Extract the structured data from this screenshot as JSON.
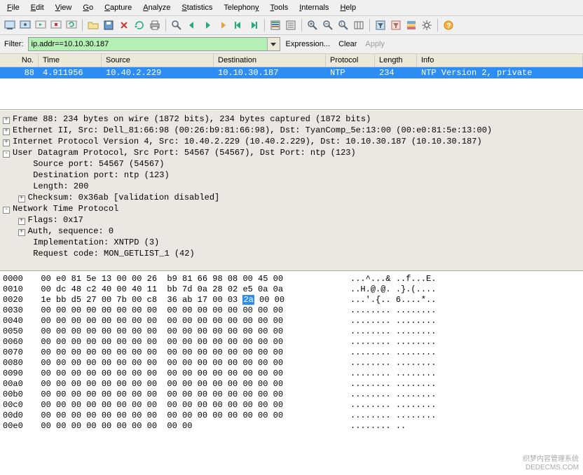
{
  "menubar": [
    {
      "l": "F",
      "t": "ile"
    },
    {
      "l": "E",
      "t": "dit"
    },
    {
      "l": "V",
      "t": "iew"
    },
    {
      "l": "G",
      "t": "o"
    },
    {
      "l": "C",
      "t": "apture"
    },
    {
      "l": "A",
      "t": "nalyze"
    },
    {
      "l": "S",
      "t": "tatistics"
    },
    {
      "l": "",
      "t": "Telephon",
      "l2": "y"
    },
    {
      "l": "T",
      "t": "ools"
    },
    {
      "l": "I",
      "t": "nternals"
    },
    {
      "l": "H",
      "t": "elp"
    }
  ],
  "filter": {
    "label": "Filter:",
    "value": "ip.addr==10.10.30.187",
    "expression_label": "Expression...",
    "clear_label": "Clear",
    "apply_label": "Apply"
  },
  "packetlist": {
    "headers": {
      "no": "No.",
      "time": "Time",
      "src": "Source",
      "dst": "Destination",
      "proto": "Protocol",
      "len": "Length",
      "info": "Info"
    },
    "rows": [
      {
        "no": "88",
        "time": "4.911956",
        "src": "10.40.2.229",
        "dst": "10.10.30.187",
        "proto": "NTP",
        "len": "234",
        "info": "NTP Version 2, private"
      }
    ]
  },
  "details": [
    {
      "exp": "+",
      "indent": 0,
      "t": "Frame 88: 234 bytes on wire (1872 bits), 234 bytes captured (1872 bits)"
    },
    {
      "exp": "+",
      "indent": 0,
      "t": "Ethernet II, Src: Dell_81:66:98 (00:26:b9:81:66:98), Dst: TyanComp_5e:13:00 (00:e0:81:5e:13:00)"
    },
    {
      "exp": "+",
      "indent": 0,
      "t": "Internet Protocol Version 4, Src: 10.40.2.229 (10.40.2.229), Dst: 10.10.30.187 (10.10.30.187)"
    },
    {
      "exp": "-",
      "indent": 0,
      "t": "User Datagram Protocol, Src Port: 54567 (54567), Dst Port: ntp (123)"
    },
    {
      "exp": "",
      "indent": 1,
      "t": "Source port: 54567 (54567)"
    },
    {
      "exp": "",
      "indent": 1,
      "t": "Destination port: ntp (123)"
    },
    {
      "exp": "",
      "indent": 1,
      "t": "Length: 200"
    },
    {
      "exp": "+",
      "indent": 1,
      "t": "Checksum: 0x36ab [validation disabled]"
    },
    {
      "exp": "-",
      "indent": 0,
      "t": "Network Time Protocol"
    },
    {
      "exp": "+",
      "indent": 1,
      "t": "Flags: 0x17"
    },
    {
      "exp": "+",
      "indent": 1,
      "t": "Auth, sequence: 0"
    },
    {
      "exp": "",
      "indent": 1,
      "t": "Implementation: XNTPD (3)"
    },
    {
      "exp": "",
      "indent": 1,
      "t": "Request code: MON_GETLIST_1 (42)"
    }
  ],
  "hexdump": [
    {
      "off": "0000",
      "b1": "00 e0 81 5e 13 00 00 26",
      "b2": "b9 81 66 98 08 00 45 00",
      "a": "...^...& ..f...E."
    },
    {
      "off": "0010",
      "b1": "00 dc 48 c2 40 00 40 11",
      "b2": "bb 7d 0a 28 02 e5 0a 0a",
      "a": "..H.@.@. .}.(...."
    },
    {
      "off": "0020",
      "b1": "1e bb d5 27 00 7b 00 c8",
      "b2": "36 ab 17 00 03 2a 00 00",
      "a": "...'.{.. 6....*..",
      "hl": [
        13
      ]
    },
    {
      "off": "0030",
      "b1": "00 00 00 00 00 00 00 00",
      "b2": "00 00 00 00 00 00 00 00",
      "a": "........ ........"
    },
    {
      "off": "0040",
      "b1": "00 00 00 00 00 00 00 00",
      "b2": "00 00 00 00 00 00 00 00",
      "a": "........ ........"
    },
    {
      "off": "0050",
      "b1": "00 00 00 00 00 00 00 00",
      "b2": "00 00 00 00 00 00 00 00",
      "a": "........ ........"
    },
    {
      "off": "0060",
      "b1": "00 00 00 00 00 00 00 00",
      "b2": "00 00 00 00 00 00 00 00",
      "a": "........ ........"
    },
    {
      "off": "0070",
      "b1": "00 00 00 00 00 00 00 00",
      "b2": "00 00 00 00 00 00 00 00",
      "a": "........ ........"
    },
    {
      "off": "0080",
      "b1": "00 00 00 00 00 00 00 00",
      "b2": "00 00 00 00 00 00 00 00",
      "a": "........ ........"
    },
    {
      "off": "0090",
      "b1": "00 00 00 00 00 00 00 00",
      "b2": "00 00 00 00 00 00 00 00",
      "a": "........ ........"
    },
    {
      "off": "00a0",
      "b1": "00 00 00 00 00 00 00 00",
      "b2": "00 00 00 00 00 00 00 00",
      "a": "........ ........"
    },
    {
      "off": "00b0",
      "b1": "00 00 00 00 00 00 00 00",
      "b2": "00 00 00 00 00 00 00 00",
      "a": "........ ........"
    },
    {
      "off": "00c0",
      "b1": "00 00 00 00 00 00 00 00",
      "b2": "00 00 00 00 00 00 00 00",
      "a": "........ ........"
    },
    {
      "off": "00d0",
      "b1": "00 00 00 00 00 00 00 00",
      "b2": "00 00 00 00 00 00 00 00",
      "a": "........ ........"
    },
    {
      "off": "00e0",
      "b1": "00 00 00 00 00 00 00 00",
      "b2": "00 00",
      "a": "........ .."
    }
  ],
  "watermark": {
    "l1": "织梦内容管理系统",
    "l2": "DEDECMS.COM"
  }
}
